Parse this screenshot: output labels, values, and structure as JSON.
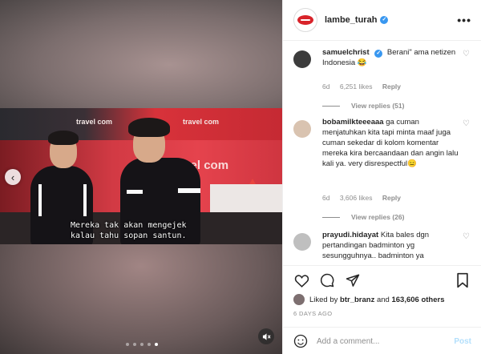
{
  "post": {
    "username": "lambe_turah",
    "more_label": "•••",
    "verified": true
  },
  "video": {
    "subtitle": "Mereka tak akan mengejek\nkalau tahu sopan santun.",
    "brand_small": "travel com",
    "brand_big": "travel com",
    "carousel_dots": 5,
    "active_dot": 4,
    "prev_icon": "chevron-left-icon",
    "mute_icon": "speaker-muted-icon"
  },
  "comments": [
    {
      "username": "samuelchrist",
      "verified": true,
      "text": "Berani\" ama netizen Indonesia 😂",
      "age": "6d",
      "likes": "6,251 likes",
      "reply_label": "Reply",
      "view_replies": "View replies (51)"
    },
    {
      "username": "bobamilkteeeaaa",
      "verified": false,
      "text": "ga cuman menjatuhkan kita tapi minta maaf juga cuman sekedar di kolom komentar mereka kira bercaandaan dan angin lalu kali ya. very disrespectful😑",
      "age": "6d",
      "likes": "3,606 likes",
      "reply_label": "Reply",
      "view_replies": "View replies (26)"
    },
    {
      "username": "prayudi.hidayat",
      "verified": false,
      "text": "Kita bales dgn pertandingan badminton yg sesungguhnya.. badminton ya",
      "age": "",
      "likes": "",
      "reply_label": "",
      "view_replies": ""
    }
  ],
  "actions": {
    "liked_prefix": "Liked by",
    "liked_user": "btr_branz",
    "liked_and": "and",
    "liked_count": "163,606 others",
    "timestamp": "6 DAYS AGO",
    "comment_placeholder": "Add a comment...",
    "post_label": "Post"
  },
  "colors": {
    "verified": "#3897f0",
    "post_disabled": "#b2dffc",
    "muted_text": "#8e8e8e",
    "lips_red": "#d8232a"
  }
}
